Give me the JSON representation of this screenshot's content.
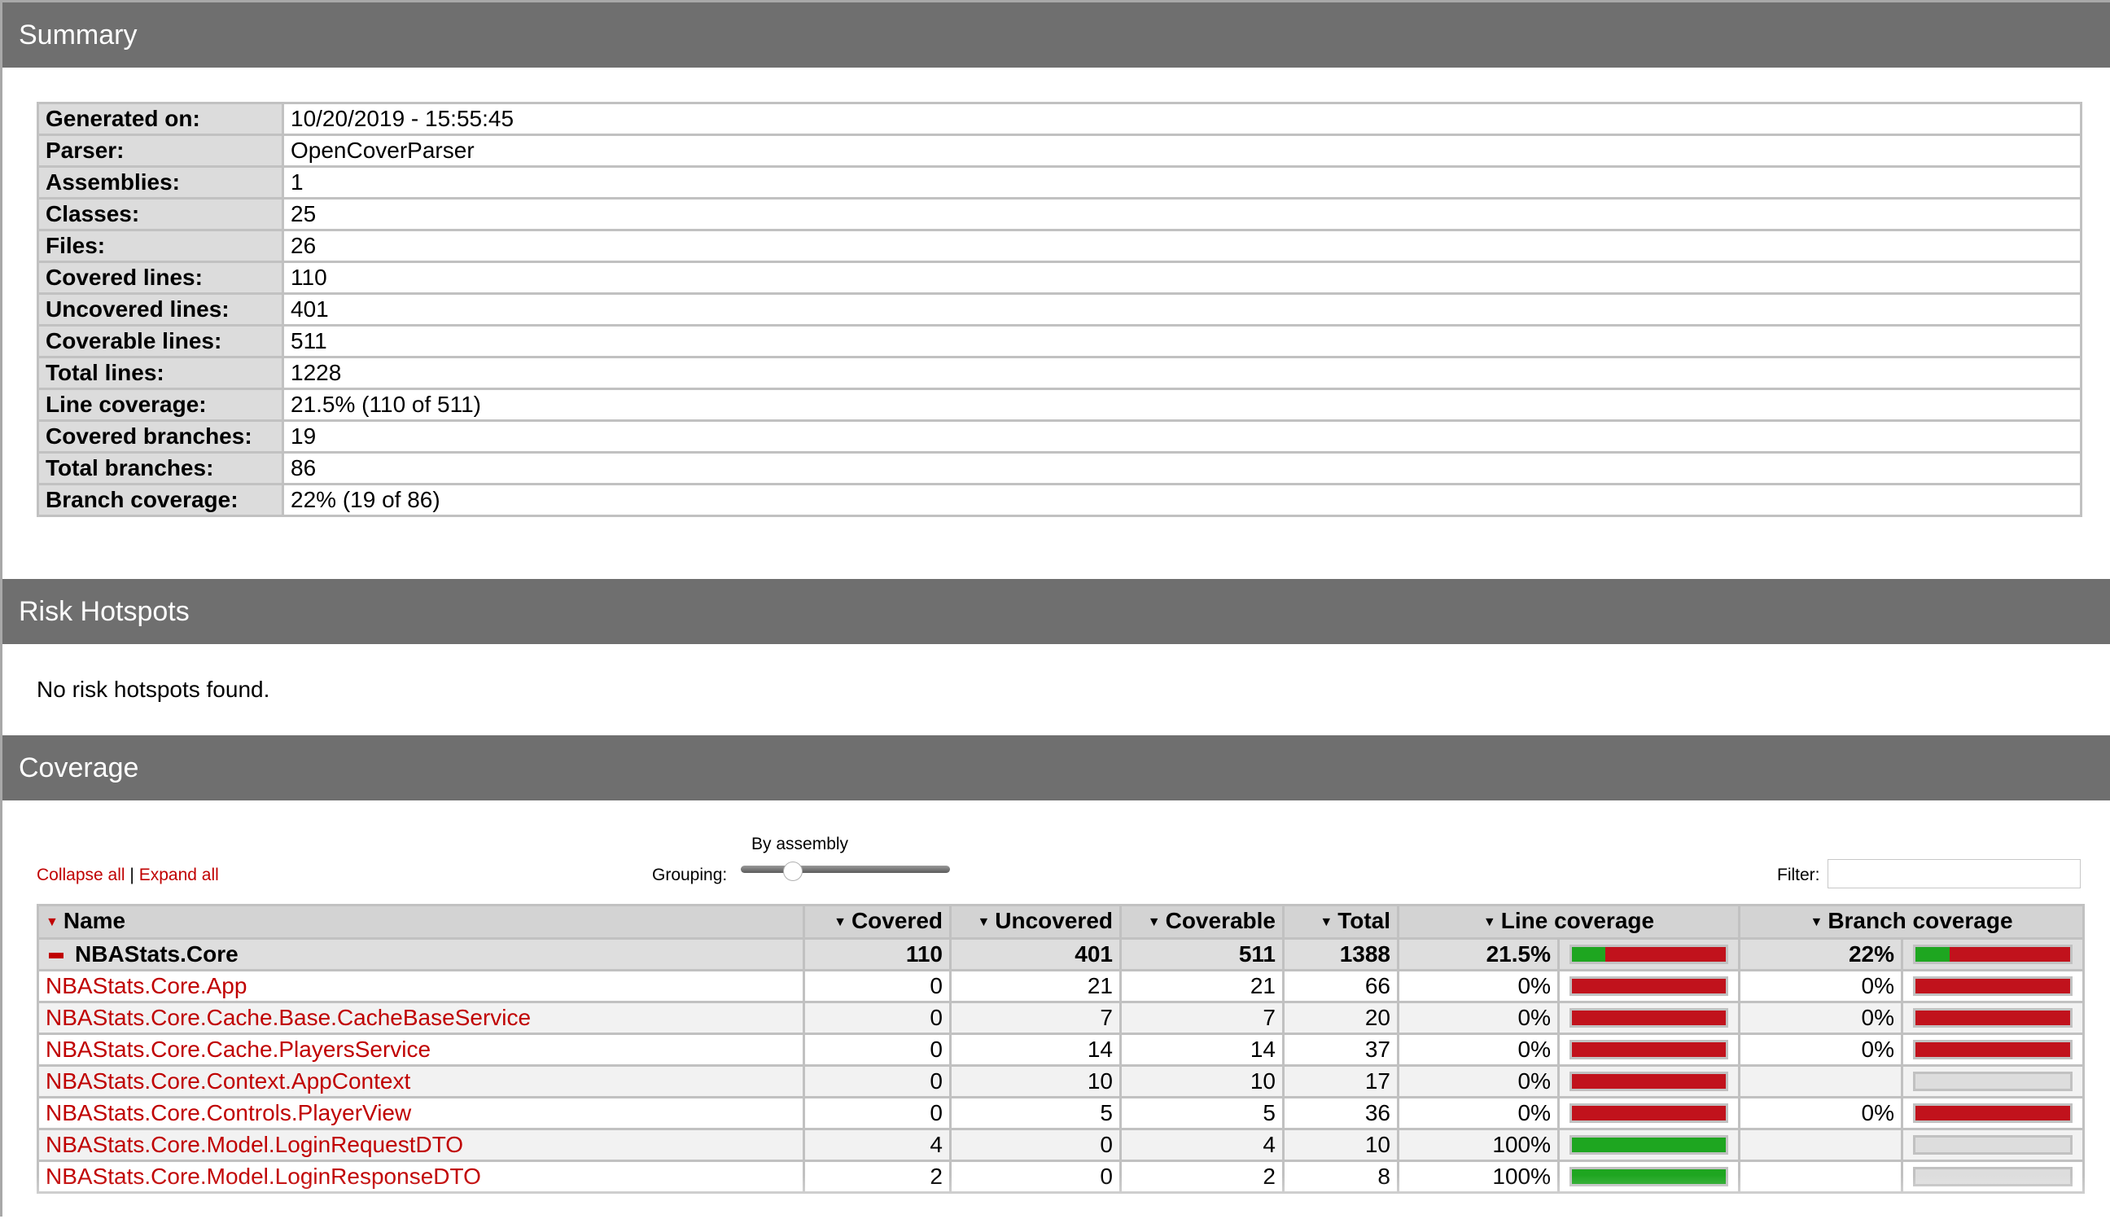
{
  "sections": {
    "summary": "Summary",
    "risk_hotspots": "Risk Hotspots",
    "coverage": "Coverage"
  },
  "summary_rows": [
    {
      "label": "Generated on:",
      "value": "10/20/2019 - 15:55:45"
    },
    {
      "label": "Parser:",
      "value": "OpenCoverParser"
    },
    {
      "label": "Assemblies:",
      "value": "1"
    },
    {
      "label": "Classes:",
      "value": "25"
    },
    {
      "label": "Files:",
      "value": "26"
    },
    {
      "label": "Covered lines:",
      "value": "110"
    },
    {
      "label": "Uncovered lines:",
      "value": "401"
    },
    {
      "label": "Coverable lines:",
      "value": "511"
    },
    {
      "label": "Total lines:",
      "value": "1228"
    },
    {
      "label": "Line coverage:",
      "value": "21.5% (110 of 511)"
    },
    {
      "label": "Covered branches:",
      "value": "19"
    },
    {
      "label": "Total branches:",
      "value": "86"
    },
    {
      "label": "Branch coverage:",
      "value": "22% (19 of 86)"
    }
  ],
  "risk_hotspots": {
    "message": "No risk hotspots found."
  },
  "toolbar": {
    "collapse_all": "Collapse all",
    "separator": "|",
    "expand_all": "Expand all",
    "grouping_label": "Grouping:",
    "grouping_value": "By assembly",
    "grouping_level": 0.25,
    "filter_label": "Filter:",
    "filter_value": ""
  },
  "colors": {
    "header_bg": "#6f6f6f",
    "link": "#c00000",
    "covered": "#1ea620",
    "uncovered": "#c1121c",
    "no_data": "#dddddd"
  },
  "columns": [
    "Name",
    "Covered",
    "Uncovered",
    "Coverable",
    "Total",
    "Line coverage",
    "Branch coverage"
  ],
  "assembly": {
    "name": "NBAStats.Core",
    "covered": "110",
    "uncovered": "401",
    "coverable": "511",
    "total": "1388",
    "line_coverage": "21.5%",
    "line_pct": 21.5,
    "branch_coverage": "22%",
    "branch_pct": 22
  },
  "classes": [
    {
      "name": "NBAStats.Core.App",
      "covered": "0",
      "uncovered": "21",
      "coverable": "21",
      "total": "66",
      "line_coverage": "0%",
      "line_pct": 0,
      "branch_coverage": "0%",
      "branch_pct": 0
    },
    {
      "name": "NBAStats.Core.Cache.Base.CacheBaseService",
      "covered": "0",
      "uncovered": "7",
      "coverable": "7",
      "total": "20",
      "line_coverage": "0%",
      "line_pct": 0,
      "branch_coverage": "0%",
      "branch_pct": 0
    },
    {
      "name": "NBAStats.Core.Cache.PlayersService",
      "covered": "0",
      "uncovered": "14",
      "coverable": "14",
      "total": "37",
      "line_coverage": "0%",
      "line_pct": 0,
      "branch_coverage": "0%",
      "branch_pct": 0
    },
    {
      "name": "NBAStats.Core.Context.AppContext",
      "covered": "0",
      "uncovered": "10",
      "coverable": "10",
      "total": "17",
      "line_coverage": "0%",
      "line_pct": 0,
      "branch_coverage": "",
      "branch_pct": null
    },
    {
      "name": "NBAStats.Core.Controls.PlayerView",
      "covered": "0",
      "uncovered": "5",
      "coverable": "5",
      "total": "36",
      "line_coverage": "0%",
      "line_pct": 0,
      "branch_coverage": "0%",
      "branch_pct": 0
    },
    {
      "name": "NBAStats.Core.Model.LoginRequestDTO",
      "covered": "4",
      "uncovered": "0",
      "coverable": "4",
      "total": "10",
      "line_coverage": "100%",
      "line_pct": 100,
      "branch_coverage": "",
      "branch_pct": null
    },
    {
      "name": "NBAStats.Core.Model.LoginResponseDTO",
      "covered": "2",
      "uncovered": "0",
      "coverable": "2",
      "total": "8",
      "line_coverage": "100%",
      "line_pct": 100,
      "branch_coverage": "",
      "branch_pct": null
    }
  ]
}
